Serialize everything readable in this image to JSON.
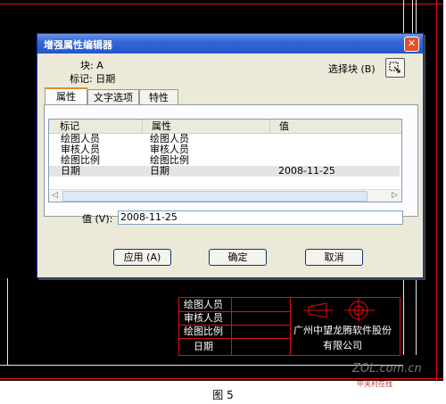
{
  "dialog": {
    "title": "增强属性编辑器",
    "close_glyph": "✕",
    "block_label": "块: A",
    "tag_label": "标记: 日期",
    "select_block_label": "选择块 (B)",
    "tabs": [
      {
        "label": "属性",
        "active": true
      },
      {
        "label": "文字选项",
        "active": false
      },
      {
        "label": "特性",
        "active": false
      }
    ],
    "table": {
      "columns": [
        "标记",
        "属性",
        "值"
      ],
      "rows": [
        {
          "tag": "绘图人员",
          "prompt": "绘图人员",
          "value": ""
        },
        {
          "tag": "审核人员",
          "prompt": "审核人员",
          "value": ""
        },
        {
          "tag": "绘图比例",
          "prompt": "绘图比例",
          "value": ""
        },
        {
          "tag": "日期",
          "prompt": "日期",
          "value": "2008-11-25",
          "selected": true
        }
      ]
    },
    "value_label": "值 (V):",
    "value_input": "2008-11-25",
    "buttons": {
      "apply": "应用 (A)",
      "ok": "确定",
      "cancel": "取消"
    }
  },
  "drawing": {
    "title_block_rows": [
      "绘图人员",
      "审核人员",
      "绘图比例",
      "日期"
    ],
    "company_line1": "广州中望龙腾软件股份",
    "company_line2": "有限公司"
  },
  "watermark": {
    "text": "ZOL.com.cn",
    "subtext": "中关村在线"
  },
  "caption": "图 5",
  "colors": {
    "canvas": "#000000",
    "drawing_line": "#e01010",
    "titlebar": "#3168d5",
    "dialog_bg": "#ece9d8"
  }
}
